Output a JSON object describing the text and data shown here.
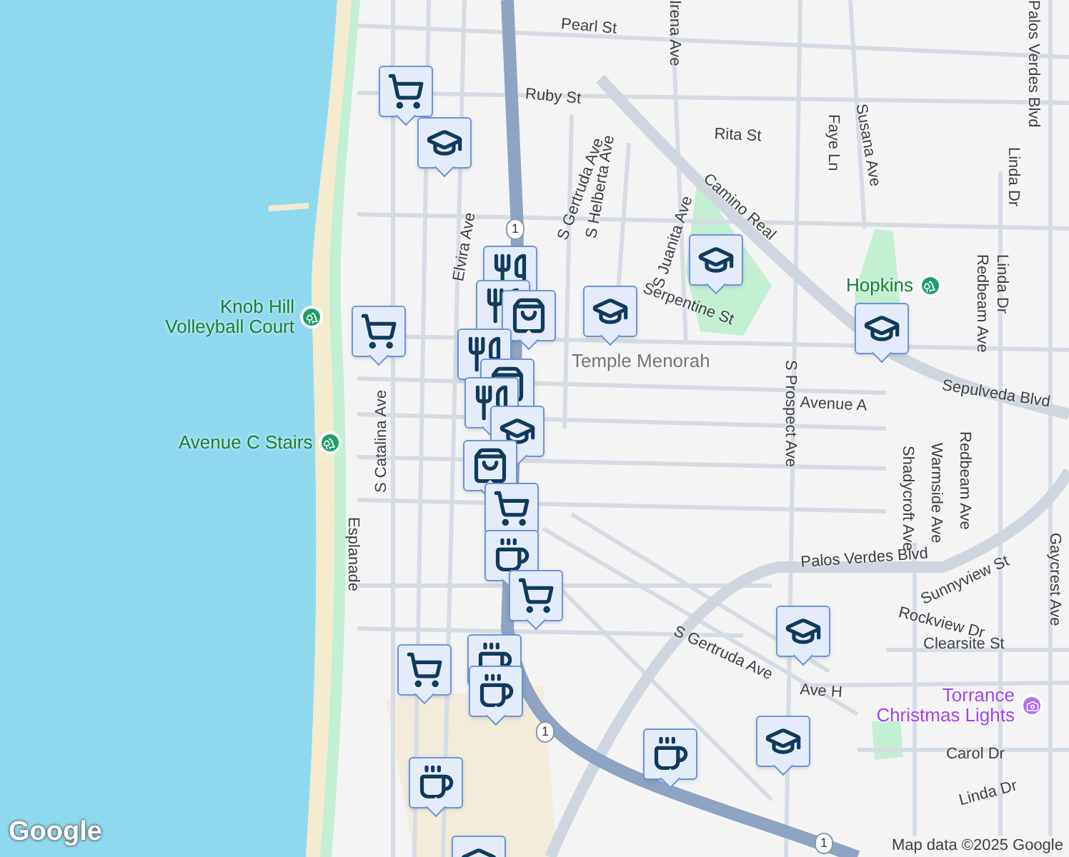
{
  "map": {
    "labels": [
      {
        "text": "Pearl St",
        "kind": "street"
      },
      {
        "text": "Ruby St",
        "kind": "street"
      },
      {
        "text": "Rita St",
        "kind": "street"
      },
      {
        "text": "Camino Real",
        "kind": "street"
      },
      {
        "text": "Serpentine St",
        "kind": "street"
      },
      {
        "text": "Temple Menorah",
        "kind": "place"
      },
      {
        "text": "Sepulveda Blvd",
        "kind": "street"
      },
      {
        "text": "Avenue A",
        "kind": "street"
      },
      {
        "text": "S Prospect Ave",
        "kind": "street"
      },
      {
        "text": "S Catalina Ave",
        "kind": "street"
      },
      {
        "text": "Esplanade",
        "kind": "street"
      },
      {
        "text": "Knob Hill Volleyball Court",
        "kind": "park"
      },
      {
        "text": "Avenue C Stairs",
        "kind": "park"
      },
      {
        "text": "Hopkins",
        "kind": "park"
      },
      {
        "text": "Palos Verdes Blvd",
        "kind": "street"
      },
      {
        "text": "Palos Verdes Blvd",
        "kind": "street"
      },
      {
        "text": "Sunnyview St",
        "kind": "street"
      },
      {
        "text": "Rockview Dr",
        "kind": "street"
      },
      {
        "text": "Clearsite St",
        "kind": "street"
      },
      {
        "text": "S Gertruda Ave",
        "kind": "street"
      },
      {
        "text": "Ave H",
        "kind": "street"
      },
      {
        "text": "Torrance Christmas Lights",
        "kind": "event"
      },
      {
        "text": "Carol Dr",
        "kind": "street"
      },
      {
        "text": "Linda Dr",
        "kind": "street"
      },
      {
        "text": "Elvira Ave",
        "kind": "street"
      },
      {
        "text": "Shadycroft Ave",
        "kind": "street"
      },
      {
        "text": "Warmside Ave",
        "kind": "street"
      },
      {
        "text": "Redbeam Ave",
        "kind": "street"
      },
      {
        "text": "Gaycrest Ave",
        "kind": "street"
      },
      {
        "text": "Redbeam Ave",
        "kind": "street"
      },
      {
        "text": "Linda Dr",
        "kind": "street"
      },
      {
        "text": "Linda Dr",
        "kind": "street"
      },
      {
        "text": "Faye Ln",
        "kind": "street"
      },
      {
        "text": "Susana Ave",
        "kind": "street"
      },
      {
        "text": "Irena Ave",
        "kind": "street"
      },
      {
        "text": "S Gertruda Ave",
        "kind": "street"
      },
      {
        "text": "S Helberta Ave",
        "kind": "street"
      },
      {
        "text": "S Juanita Ave",
        "kind": "street"
      },
      {
        "text": "1",
        "kind": "shield"
      },
      {
        "text": "1",
        "kind": "shield"
      },
      {
        "text": "1",
        "kind": "shield"
      }
    ],
    "markers": [
      {
        "kind": "cart"
      },
      {
        "kind": "school"
      },
      {
        "kind": "cart"
      },
      {
        "kind": "restaurant"
      },
      {
        "kind": "restaurant"
      },
      {
        "kind": "shop"
      },
      {
        "kind": "restaurant"
      },
      {
        "kind": "shop"
      },
      {
        "kind": "restaurant"
      },
      {
        "kind": "school"
      },
      {
        "kind": "shop"
      },
      {
        "kind": "cart"
      },
      {
        "kind": "cafe"
      },
      {
        "kind": "cart"
      },
      {
        "kind": "cafe"
      },
      {
        "kind": "cafe"
      },
      {
        "kind": "cart"
      },
      {
        "kind": "cafe"
      },
      {
        "kind": "school"
      },
      {
        "kind": "school"
      },
      {
        "kind": "school"
      },
      {
        "kind": "school"
      },
      {
        "kind": "school"
      },
      {
        "kind": "school"
      },
      {
        "kind": "cafe"
      }
    ],
    "logo": "Google",
    "attribution": "Map data ©2025 Google"
  }
}
